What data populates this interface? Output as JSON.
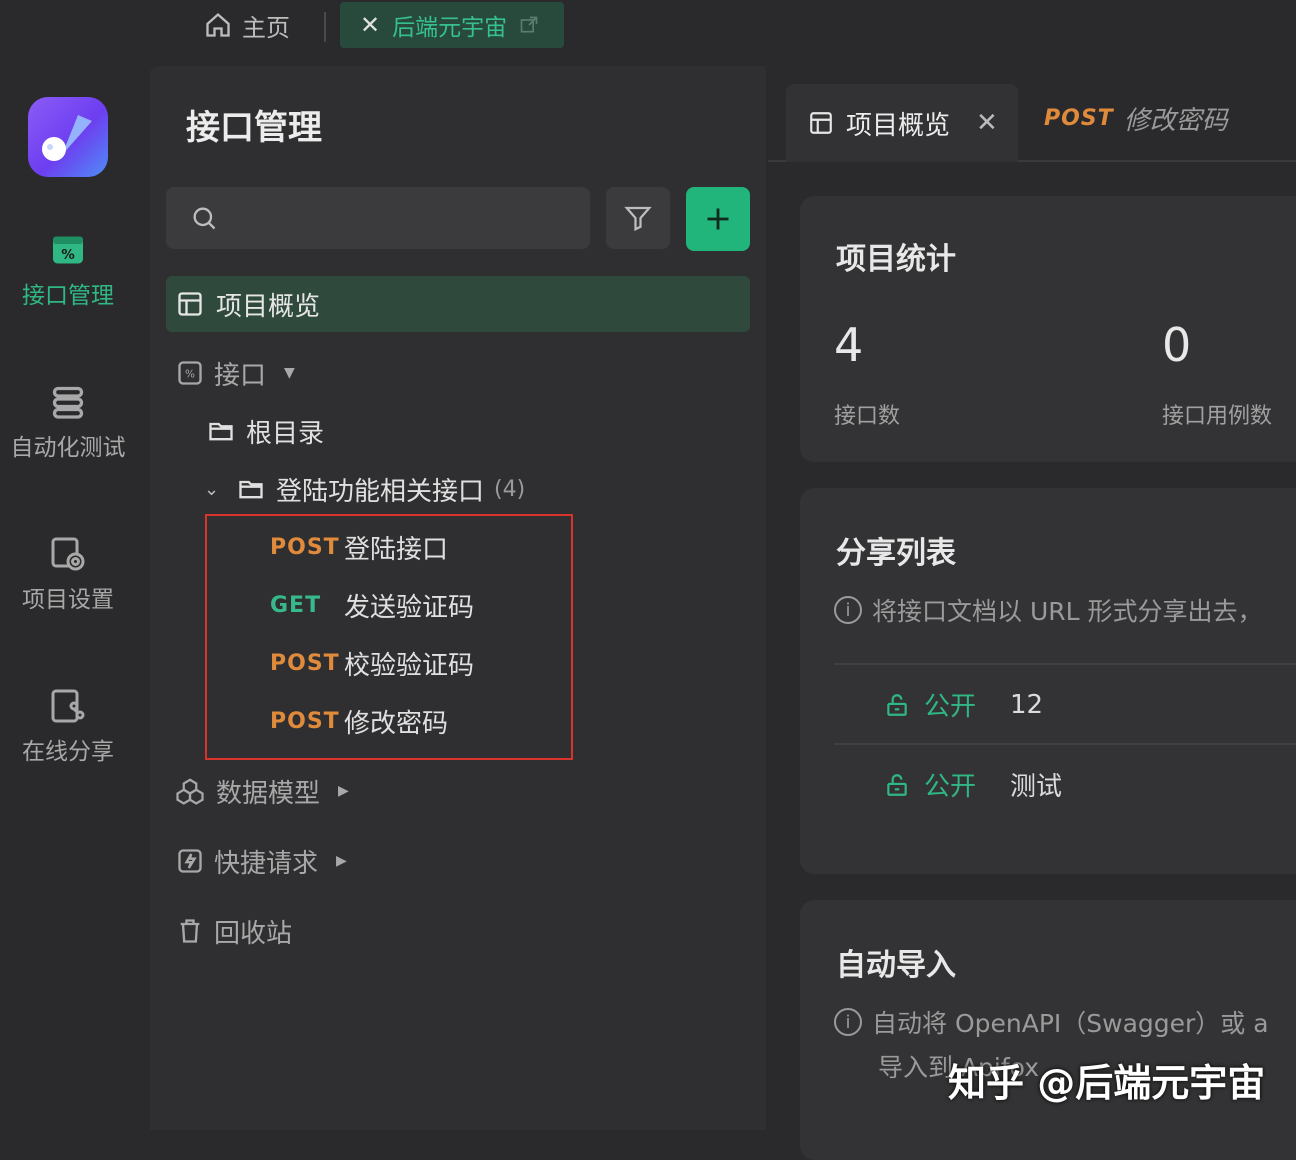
{
  "topbar": {
    "home_label": "主页",
    "tab_label": "后端元宇宙"
  },
  "rail": {
    "items": [
      {
        "label": "接口管理",
        "icon": "api-icon",
        "active": true
      },
      {
        "label": "自动化测试",
        "icon": "test-icon"
      },
      {
        "label": "项目设置",
        "icon": "settings-icon"
      },
      {
        "label": "在线分享",
        "icon": "share-icon"
      }
    ]
  },
  "sidebar": {
    "title": "接口管理",
    "search_placeholder": "",
    "overview": "项目概览",
    "api_group": "接口",
    "root": "根目录",
    "folder": "登陆功能相关接口",
    "folder_count": "(4)",
    "apis": [
      {
        "method": "POST",
        "name": "登陆接口"
      },
      {
        "method": "GET",
        "name": "发送验证码"
      },
      {
        "method": "POST",
        "name": "校验验证码"
      },
      {
        "method": "POST",
        "name": "修改密码"
      }
    ],
    "models": "数据模型",
    "quick": "快捷请求",
    "trash": "回收站"
  },
  "main": {
    "tabs": [
      {
        "label": "项目概览",
        "active": true
      },
      {
        "method": "POST",
        "label": "修改密码"
      }
    ],
    "stats": {
      "title": "项目统计",
      "items": [
        {
          "value": "4",
          "label": "接口数"
        },
        {
          "value": "0",
          "label": "接口用例数"
        }
      ]
    },
    "share": {
      "title": "分享列表",
      "info": "将接口文档以 URL 形式分享出去，",
      "rows": [
        {
          "status": "公开",
          "name": "12"
        },
        {
          "status": "公开",
          "name": "测试"
        }
      ]
    },
    "import": {
      "title": "自动导入",
      "info_line1": "自动将 OpenAPI（Swagger）或 a",
      "info_line2": "导入到 Apifox"
    }
  },
  "watermark": "知乎 @后端元宇宙",
  "colors": {
    "accent_green": "#21b57c",
    "post_orange": "#e08a3c",
    "get_green": "#37b98b",
    "highlight_red": "#d9342c"
  }
}
